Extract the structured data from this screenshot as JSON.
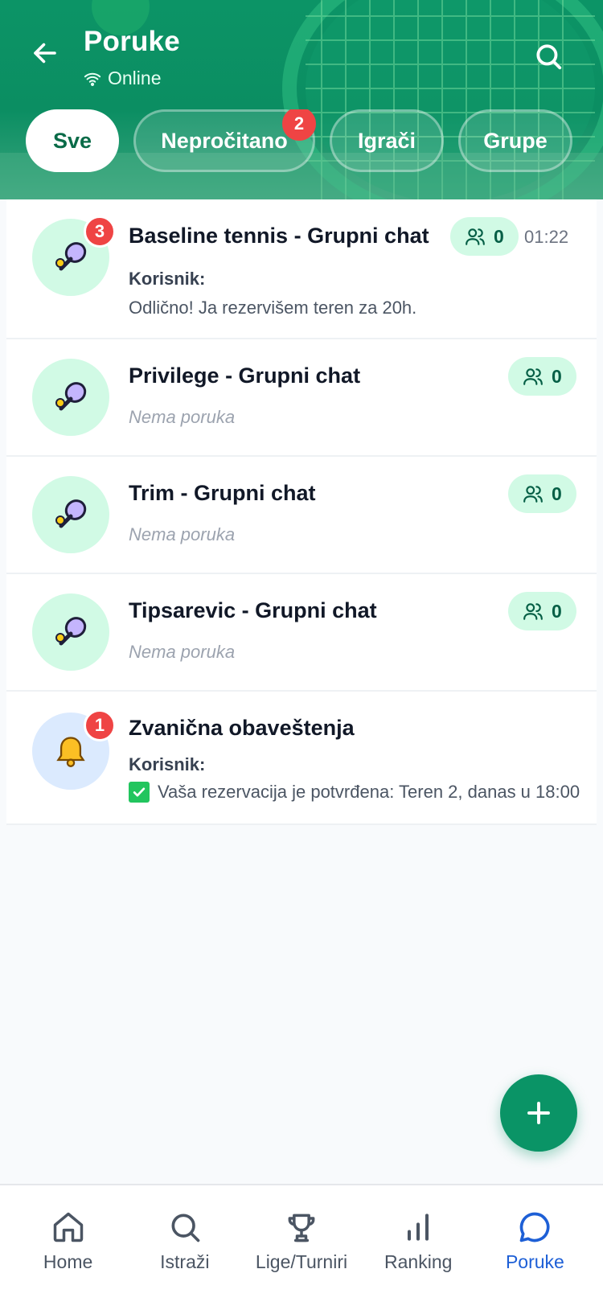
{
  "header": {
    "title": "Poruke",
    "status": "Online",
    "back_icon": "arrow-left-icon",
    "search_icon": "search-icon"
  },
  "tabs": [
    {
      "label": "Sve",
      "active": true
    },
    {
      "label": "Nepročitano",
      "badge": "2"
    },
    {
      "label": "Igrači"
    },
    {
      "label": "Grupe"
    }
  ],
  "chats": [
    {
      "name": "Baseline tennis - Grupni chat",
      "icon": "tennis-racket-icon",
      "unread": "3",
      "members": "0",
      "time": "01:22",
      "sender": "Korisnik:",
      "preview": "Odlično! Ja rezervišem teren za 20h."
    },
    {
      "name": "Privilege - Grupni chat",
      "icon": "tennis-racket-icon",
      "members": "0",
      "preview": "Nema poruka"
    },
    {
      "name": "Trim - Grupni chat",
      "icon": "tennis-racket-icon",
      "members": "0",
      "preview": "Nema poruka"
    },
    {
      "name": "Tipsarevic - Grupni chat",
      "icon": "tennis-racket-icon",
      "members": "0",
      "preview": "Nema poruka"
    },
    {
      "name": "Zvanična obaveštenja",
      "icon": "bell-icon",
      "unread": "1",
      "sender": "Korisnik:",
      "preview": "Vaša rezervacija je potvrđena: Teren 2, danas u 18:00"
    }
  ],
  "fab": {
    "icon": "plus-icon"
  },
  "nav": [
    {
      "label": "Home",
      "icon": "home-icon"
    },
    {
      "label": "Istraži",
      "icon": "search-icon"
    },
    {
      "label": "Lige/Turniri",
      "icon": "trophy-icon"
    },
    {
      "label": "Ranking",
      "icon": "bar-chart-icon"
    },
    {
      "label": "Poruke",
      "icon": "chat-bubble-icon",
      "active": true
    }
  ],
  "colors": {
    "header_green": "#0c9466",
    "accent_blue": "#1d5fd6",
    "badge_red": "#ef4444",
    "member_pill": "#d1fae5"
  }
}
